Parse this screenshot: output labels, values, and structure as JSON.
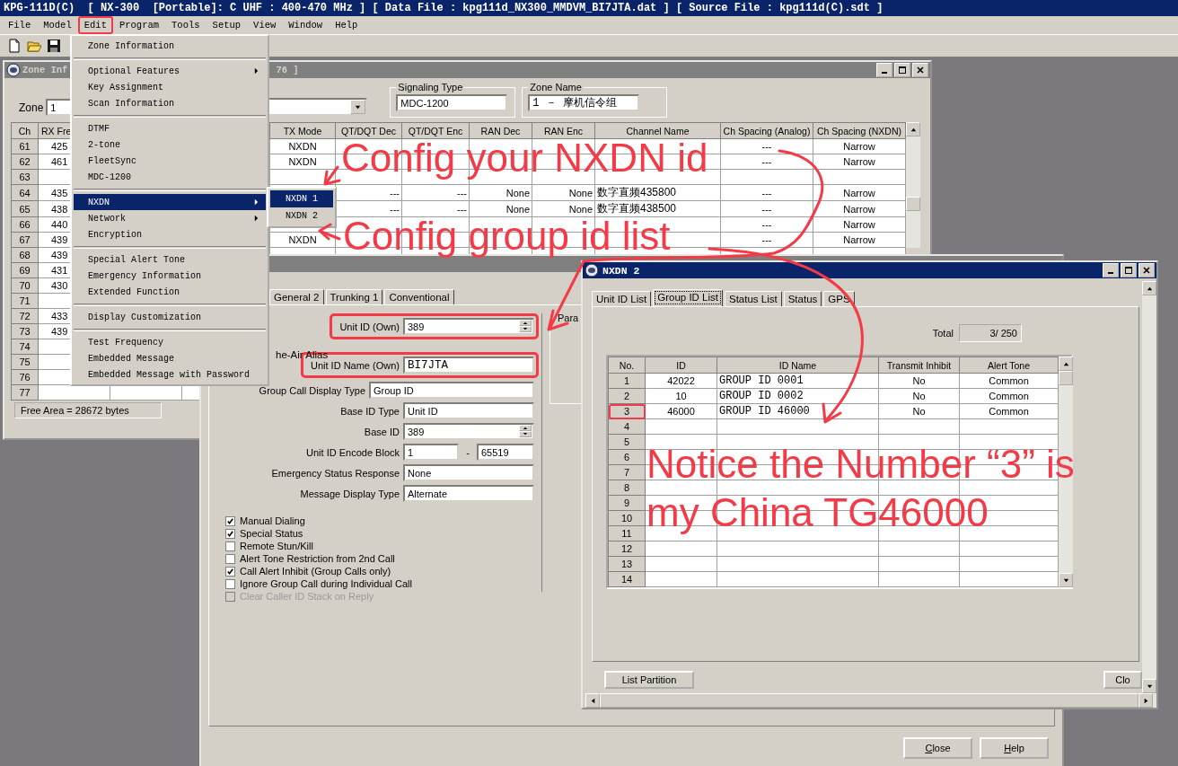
{
  "window": {
    "title": "KPG-111D(C)  [ NX-300  [Portable]: C UHF : 400-470 MHz ] [ Data File : kpg111d_NX300_MMDVM_BI7JTA.dat ] [ Source File : kpg111d(C).sdt ]"
  },
  "menu_bar": [
    {
      "label": "File",
      "selected": false
    },
    {
      "label": "Model",
      "selected": false
    },
    {
      "label": "Edit",
      "selected": true
    },
    {
      "label": "Program",
      "selected": false
    },
    {
      "label": "Tools",
      "selected": false
    },
    {
      "label": "Setup",
      "selected": false
    },
    {
      "label": "View",
      "selected": false
    },
    {
      "label": "Window",
      "selected": false
    },
    {
      "label": "Help",
      "selected": false
    }
  ],
  "edit_menu": [
    [
      {
        "label": "Zone Information",
        "has_submenu": false,
        "selected": false
      }
    ],
    [
      {
        "label": "Optional Features",
        "has_submenu": true,
        "selected": false
      },
      {
        "label": "Key Assignment",
        "has_submenu": false,
        "selected": false
      },
      {
        "label": "Scan Information",
        "has_submenu": false,
        "selected": false
      }
    ],
    [
      {
        "label": "DTMF",
        "has_submenu": false,
        "selected": false
      },
      {
        "label": "2-tone",
        "has_submenu": false,
        "selected": false
      },
      {
        "label": "FleetSync",
        "has_submenu": false,
        "selected": false
      },
      {
        "label": "MDC-1200",
        "has_submenu": false,
        "selected": false
      }
    ],
    [
      {
        "label": "NXDN",
        "has_submenu": true,
        "selected": true
      },
      {
        "label": "Network",
        "has_submenu": true,
        "selected": false
      },
      {
        "label": "Encryption",
        "has_submenu": false,
        "selected": false
      }
    ],
    [
      {
        "label": "Special Alert Tone",
        "has_submenu": false,
        "selected": false
      },
      {
        "label": "Emergency Information",
        "has_submenu": false,
        "selected": false
      },
      {
        "label": "Extended Function",
        "has_submenu": false,
        "selected": false
      }
    ],
    [
      {
        "label": "Display Customization",
        "has_submenu": false,
        "selected": false
      }
    ],
    [
      {
        "label": "Test Frequency",
        "has_submenu": false,
        "selected": false
      },
      {
        "label": "Embedded Message",
        "has_submenu": false,
        "selected": false
      },
      {
        "label": "Embedded Message with Password",
        "has_submenu": false,
        "selected": false
      }
    ]
  ],
  "nxdn_submenu": [
    {
      "label": "NXDN 1",
      "selected": true
    },
    {
      "label": "NXDN 2",
      "selected": false
    }
  ],
  "zone_window": {
    "title_start": "Zone Inf",
    "title_end": "76 ]",
    "zone_label": "Zone",
    "zone_value": "1",
    "signaling_type": {
      "label": "Signaling Type",
      "value": "MDC-1200"
    },
    "zone_name": {
      "label": "Zone Name",
      "value": "1 － 摩机信令组"
    },
    "columns": [
      "Ch",
      "RX Fre",
      "TX Mode",
      "QT/DQT Dec",
      "QT/DQT Enc",
      "RAN Dec",
      "RAN Enc",
      "Channel Name",
      "Ch Spacing (Analog)",
      "Ch Spacing (NXDN)"
    ],
    "rows": [
      {
        "ch": "61",
        "rx": "425",
        "tx_mode": "NXDN",
        "spacing_analog": "---",
        "spacing_nxdn": "Narrow"
      },
      {
        "ch": "62",
        "rx": "461",
        "tx_mode": "NXDN",
        "spacing_analog": "---",
        "spacing_nxdn": "Narrow"
      },
      {
        "ch": "63"
      },
      {
        "ch": "64",
        "rx": "435",
        "qt_dec": "---",
        "qt_enc": "---",
        "ran_dec": "None",
        "ran_enc": "None",
        "channel_name": "数字直频435800",
        "spacing_analog": "---",
        "spacing_nxdn": "Narrow"
      },
      {
        "ch": "65",
        "rx": "438",
        "qt_dec": "---",
        "qt_enc": "---",
        "ran_dec": "None",
        "ran_enc": "None",
        "channel_name": "数字直频438500",
        "spacing_analog": "---",
        "spacing_nxdn": "Narrow"
      },
      {
        "ch": "66",
        "rx": "440",
        "spacing_analog": "---",
        "spacing_nxdn": "Narrow"
      },
      {
        "ch": "67",
        "rx": "439",
        "tx_mode": "NXDN",
        "spacing_analog": "---",
        "spacing_nxdn": "Narrow"
      },
      {
        "ch": "68",
        "rx": "439"
      },
      {
        "ch": "69",
        "rx": "431"
      },
      {
        "ch": "70",
        "rx": "430"
      },
      {
        "ch": "71"
      },
      {
        "ch": "72",
        "rx": "433"
      },
      {
        "ch": "73",
        "rx": "439"
      },
      {
        "ch": "74"
      },
      {
        "ch": "75"
      },
      {
        "ch": "76"
      },
      {
        "ch": "77"
      }
    ],
    "free_area": "Free Area = 28672 bytes"
  },
  "unit_window": {
    "tabs": [
      {
        "label": "General 2",
        "selected": false
      },
      {
        "label": "Trunking 1",
        "selected": false
      },
      {
        "label": "Conventional",
        "selected": false
      }
    ],
    "alias_label": "he-Air Alias",
    "params_label": "Para",
    "fields": [
      {
        "kind": "spin",
        "label": "Unit ID (Own)",
        "value": "389",
        "annotated": true
      },
      {
        "kind": "gap"
      },
      {
        "kind": "mono",
        "label": "Unit ID Name (Own)",
        "value": "BI7JTA",
        "annotated": true
      },
      {
        "kind": "wide",
        "label": "Group Call Display Type",
        "value": "Group ID",
        "annotated": false
      },
      {
        "kind": "text",
        "label": "Base ID Type",
        "value": "Unit ID",
        "annotated": false
      },
      {
        "kind": "spin",
        "label": "Base ID",
        "value": "389",
        "annotated": false
      },
      {
        "kind": "range",
        "label": "Unit ID Encode Block",
        "value": "1",
        "separator": "-",
        "value_to": "65519",
        "annotated": false
      },
      {
        "kind": "text",
        "label": "Emergency Status Response",
        "value": "None",
        "annotated": false
      },
      {
        "kind": "text",
        "label": "Message Display Type",
        "value": "Alternate",
        "annotated": false
      }
    ],
    "checkboxes": [
      {
        "label": "Manual Dialing",
        "checked": true,
        "disabled": false
      },
      {
        "label": "Special Status",
        "checked": true,
        "disabled": false
      },
      {
        "label": "Remote Stun/Kill",
        "checked": false,
        "disabled": false
      },
      {
        "label": "Alert Tone Restriction from 2nd Call",
        "checked": false,
        "disabled": false
      },
      {
        "label": "Call Alert Inhibit (Group Calls only)",
        "checked": true,
        "disabled": false
      },
      {
        "label": "Ignore Group Call during Individual Call",
        "checked": false,
        "disabled": false
      },
      {
        "label": "Clear Caller ID Stack on Reply",
        "checked": false,
        "disabled": true
      }
    ],
    "buttons": [
      "Close",
      "Help"
    ]
  },
  "nxdn2_window": {
    "title": "NXDN 2",
    "tabs": [
      {
        "label": "Unit ID List",
        "selected": false
      },
      {
        "label": "Group ID List",
        "selected": true
      },
      {
        "label": "Status List",
        "selected": false
      },
      {
        "label": "Status",
        "selected": false
      },
      {
        "label": "GPS",
        "selected": false
      }
    ],
    "total_label": "Total",
    "total_value": "3/ 250",
    "columns": [
      "No.",
      "ID",
      "ID Name",
      "Transmit Inhibit",
      "Alert Tone"
    ],
    "rows": [
      {
        "no": "1",
        "id": "42022",
        "name": "GROUP ID 0001",
        "inhibit": "No",
        "alert": "Common",
        "annotated": false
      },
      {
        "no": "2",
        "id": "10",
        "name": "GROUP ID 0002",
        "inhibit": "No",
        "alert": "Common",
        "annotated": false
      },
      {
        "no": "3",
        "id": "46000",
        "name": "GROUP ID 46000",
        "inhibit": "No",
        "alert": "Common",
        "annotated": true
      },
      {
        "no": "4",
        "annotated": false
      },
      {
        "no": "5",
        "annotated": false
      },
      {
        "no": "6",
        "annotated": false
      },
      {
        "no": "7",
        "annotated": false
      },
      {
        "no": "8",
        "annotated": false
      },
      {
        "no": "9",
        "annotated": false
      },
      {
        "no": "10",
        "annotated": false
      },
      {
        "no": "11",
        "annotated": false
      },
      {
        "no": "12",
        "annotated": false
      },
      {
        "no": "13",
        "annotated": false
      },
      {
        "no": "14",
        "annotated": false
      }
    ],
    "buttons": [
      "List Partition",
      "Clo"
    ]
  },
  "annotations": [
    "Config your NXDN id",
    "Config group id list",
    "Notice the Number “3” is my China TG46000"
  ]
}
